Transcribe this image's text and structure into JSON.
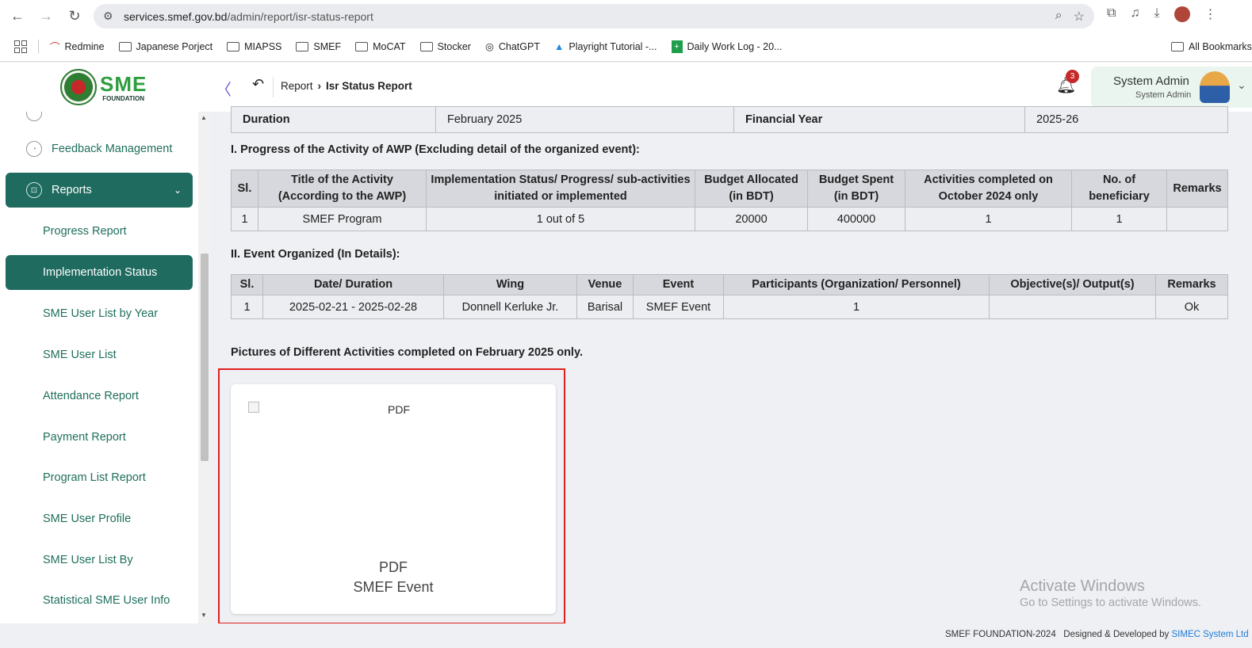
{
  "browser": {
    "url_host": "services.smef.gov.bd",
    "url_path": "/admin/report/isr-status-report",
    "bookmarks": [
      "Redmine",
      "Japanese Porject",
      "MIAPSS",
      "SMEF",
      "MoCAT",
      "Stocker",
      "ChatGPT",
      "Playright Tutorial -...",
      "Daily Work Log - 20...",
      "All Bookmarks"
    ]
  },
  "header": {
    "logo_text": "SME",
    "logo_sub": "FOUNDATION",
    "breadcrumb_parent": "Report",
    "breadcrumb_current": "Isr Status Report",
    "notification_count": "3",
    "user_name": "System Admin",
    "user_role": "System Admin"
  },
  "sidebar": {
    "feedback": "Feedback Management",
    "reports": "Reports",
    "items": [
      "Progress Report",
      "Implementation Status",
      "SME User List by Year",
      "SME User List",
      "Attendance Report",
      "Payment Report",
      "Program List Report",
      "SME User Profile",
      "SME User List By",
      "Statistical SME User Info"
    ]
  },
  "duration_row": {
    "duration_label": "Duration",
    "duration_value": "February 2025",
    "fy_label": "Financial Year",
    "fy_value": "2025-26"
  },
  "section1": {
    "title": "I. Progress of the Activity of AWP (Excluding detail of the organized event):",
    "headers": [
      "Sl.",
      "Title of the Activity (According to the AWP)",
      "Implementation Status/ Progress/ sub-activities initiated or implemented",
      "Budget Allocated (in BDT)",
      "Budget Spent (in BDT)",
      "Activities completed on October 2024 only",
      "No. of beneficiary",
      "Remarks"
    ],
    "row": [
      "1",
      "SMEF Program",
      "1 out of 5",
      "20000",
      "400000",
      "1",
      "1",
      ""
    ]
  },
  "section2": {
    "title": "II. Event Organized (In Details):",
    "headers": [
      "Sl.",
      "Date/ Duration",
      "Wing",
      "Venue",
      "Event",
      "Participants (Organization/ Personnel)",
      "Objective(s)/ Output(s)",
      "Remarks"
    ],
    "row": [
      "1",
      "2025-02-21 - 2025-02-28",
      "Donnell Kerluke Jr.",
      "Barisal",
      "SMEF Event",
      "1",
      "",
      "Ok"
    ]
  },
  "section3": {
    "title": "Pictures of Different Activities completed on February 2025 only.",
    "card_alt": "PDF",
    "card_type": "PDF",
    "card_event": "SMEF Event"
  },
  "watermark": {
    "line1": "Activate Windows",
    "line2": "Go to Settings to activate Windows."
  },
  "footer": {
    "text": "SMEF FOUNDATION-2024   Designed & Developed by",
    "link": "SIMEC System Ltd"
  }
}
